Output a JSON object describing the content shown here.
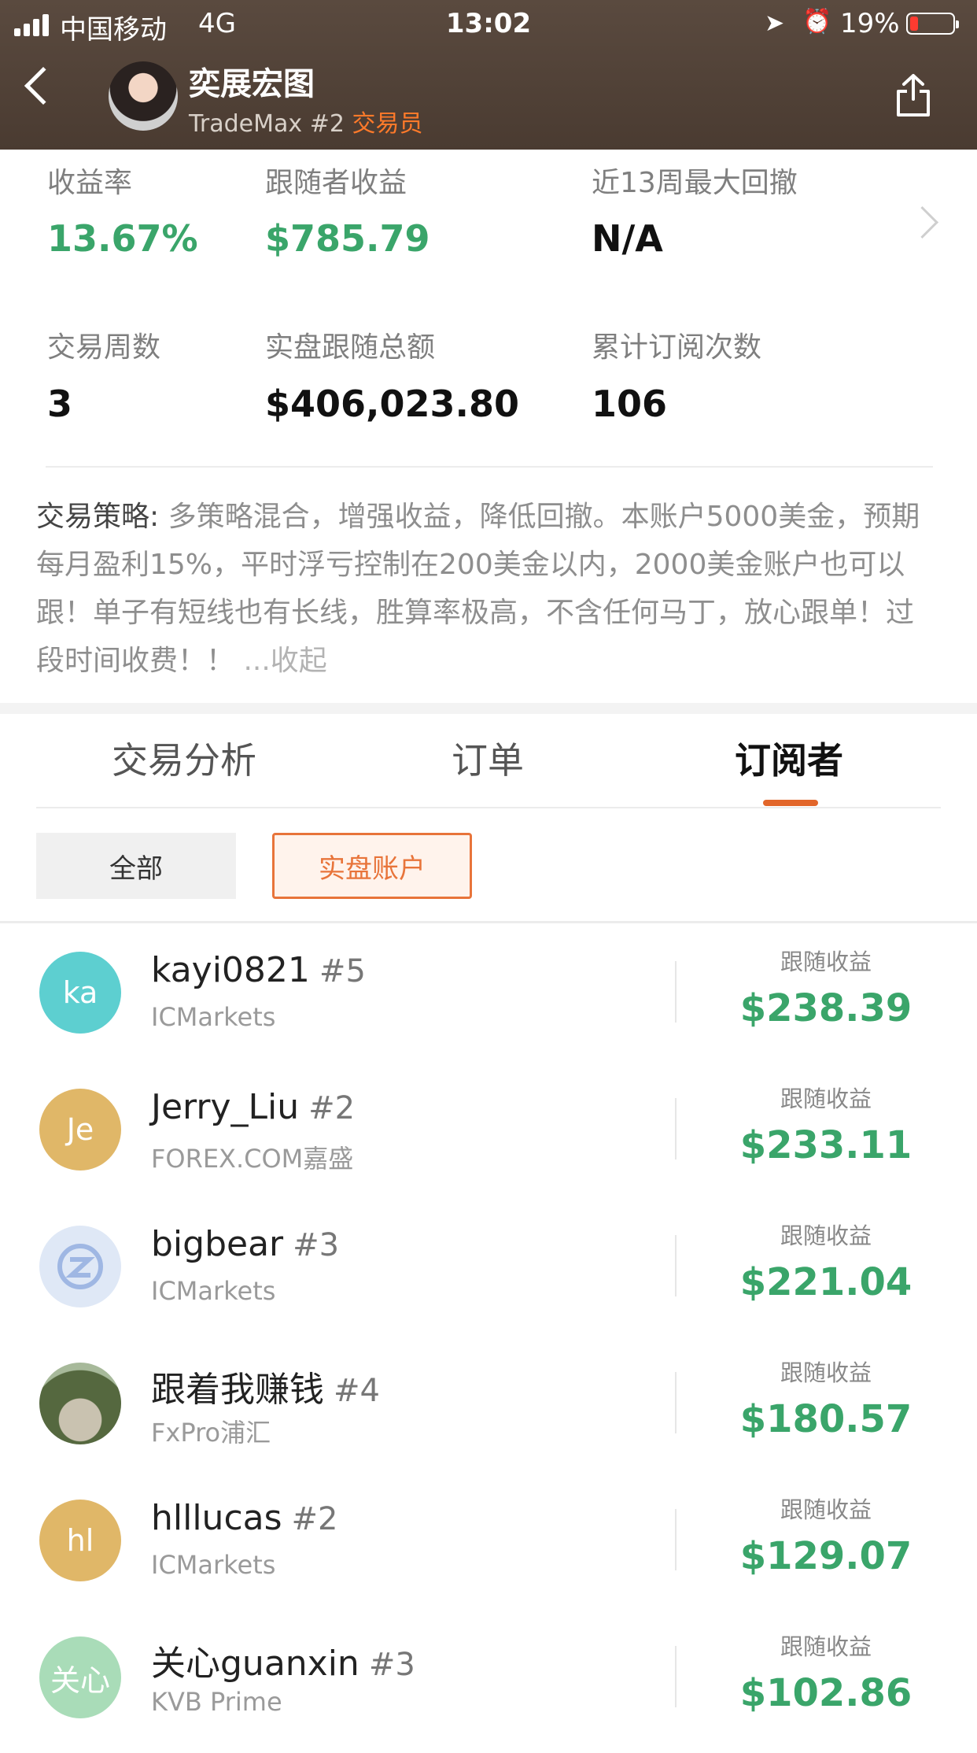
{
  "status_bar": {
    "carrier": "中国移动",
    "network": "4G",
    "time": "13:02",
    "battery": "19%",
    "battery_level": 0.19,
    "battery_color": "#ff3b30"
  },
  "nav": {
    "back_icon": "chevron-left-icon",
    "trader_name": "奕展宏图",
    "platform": "TradeMax #2",
    "role": "交易员",
    "share_icon": "share-icon"
  },
  "stats": {
    "return_rate": {
      "label": "收益率",
      "value": "13.67%"
    },
    "follower_profit": {
      "label": "跟随者收益",
      "value": "$785.79"
    },
    "max_drawdown": {
      "label": "近13周最大回撤",
      "value": "N/A"
    },
    "trading_weeks": {
      "label": "交易周数",
      "value": "3"
    },
    "live_follow_total": {
      "label": "实盘跟随总额",
      "value": "$406,023.80"
    },
    "subscription_count": {
      "label": "累计订阅次数",
      "value": "106"
    }
  },
  "strategy": {
    "label": "交易策略:",
    "text": " 多策略混合，增强收益，降低回撤。本账户5000美金，预期每月盈利15%，平时浮亏控制在200美金以内，2000美金账户也可以跟！单子有短线也有长线，胜算率极高，不含任何马丁，放心跟单！过段时间收费！！",
    "collapse": " ...收起"
  },
  "tabs": [
    {
      "label": "交易分析"
    },
    {
      "label": "订单"
    },
    {
      "label": "订阅者"
    }
  ],
  "filters": {
    "all": "全部",
    "live": "实盘账户"
  },
  "colors": {
    "accent": "#e8743a",
    "profit": "#3aa56a"
  },
  "subscribers": [
    {
      "initials": "ka",
      "name": "kayi0821",
      "rank": "#5",
      "broker": "ICMarkets",
      "profit_label": "跟随收益",
      "profit": "$238.39",
      "avatar_color": "#5dcfd0"
    },
    {
      "initials": "Je",
      "name": "Jerry_Liu",
      "rank": "#2",
      "broker": "FOREX.COM嘉盛",
      "profit_label": "跟随收益",
      "profit": "$233.11",
      "avatar_color": "#e0b768"
    },
    {
      "initials": "",
      "name": "bigbear",
      "rank": "#3",
      "broker": "ICMarkets",
      "profit_label": "跟随收益",
      "profit": "$221.04",
      "avatar_color": "#dfe8f6"
    },
    {
      "initials": "",
      "name": "跟着我赚钱",
      "rank": "#4",
      "broker": "FxPro浦汇",
      "profit_label": "跟随收益",
      "profit": "$180.57",
      "avatar_color": "#6d7a5c"
    },
    {
      "initials": "hl",
      "name": "hlllucas",
      "rank": "#2",
      "broker": "ICMarkets",
      "profit_label": "跟随收益",
      "profit": "$129.07",
      "avatar_color": "#e0b768"
    },
    {
      "initials": "关心",
      "name": "关心guanxin",
      "rank": "#3",
      "broker": "KVB Prime",
      "profit_label": "跟随收益",
      "profit": "$102.86",
      "avatar_color": "#a9dcb8"
    }
  ]
}
